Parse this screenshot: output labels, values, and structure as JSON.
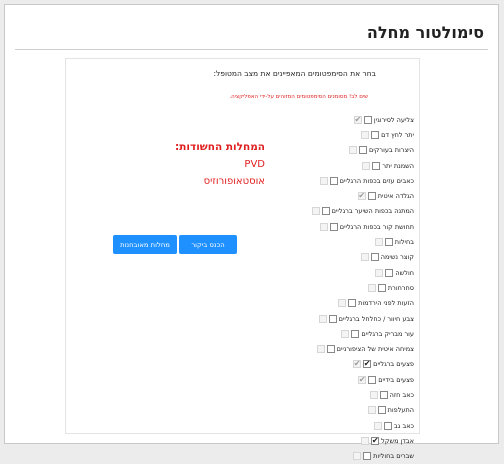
{
  "page": {
    "title": "סימולטור מחלה"
  },
  "form": {
    "instruction": "בחר את הסימפטומים המאפיינים את מצב המטופל:",
    "warning": "שים לב! מסומנים הסימפטומים המזוהים על-ידי האפליקציה."
  },
  "symptoms": [
    {
      "label": "צליעה לסירוגין",
      "user_checked": false,
      "app_checked": true
    },
    {
      "label": "יתר לחץ דם",
      "user_checked": false,
      "app_checked": false
    },
    {
      "label": "היצרות בעורקים",
      "user_checked": false,
      "app_checked": false
    },
    {
      "label": "השמנת יתר",
      "user_checked": false,
      "app_checked": false
    },
    {
      "label": "כאבים עזים בכפות הרגליים",
      "user_checked": false,
      "app_checked": false
    },
    {
      "label": "הגלדה איטית",
      "user_checked": false,
      "app_checked": true
    },
    {
      "label": "המתנה בכפות השיער ברגליים",
      "user_checked": false,
      "app_checked": false
    },
    {
      "label": "תחושת קור בכפות הרגליים",
      "user_checked": false,
      "app_checked": false
    },
    {
      "label": "בחילות",
      "user_checked": false,
      "app_checked": false
    },
    {
      "label": "קוצר נשימה",
      "user_checked": false,
      "app_checked": false
    },
    {
      "label": "חולשה",
      "user_checked": false,
      "app_checked": false
    },
    {
      "label": "סחרחורת",
      "user_checked": false,
      "app_checked": false
    },
    {
      "label": "הזעות לפני הירדמות",
      "user_checked": false,
      "app_checked": false
    },
    {
      "label": "צבע חיוור / כחלחל ברגליים",
      "user_checked": false,
      "app_checked": false
    },
    {
      "label": "עור מבריק ברגליים",
      "user_checked": false,
      "app_checked": false
    },
    {
      "label": "צמיחה איטית של הציפורניים",
      "user_checked": false,
      "app_checked": false
    },
    {
      "label": "פצעים ברגליים",
      "user_checked": true,
      "app_checked": true
    },
    {
      "label": "פצעים בידיים",
      "user_checked": false,
      "app_checked": true
    },
    {
      "label": "כאב חזה",
      "user_checked": false,
      "app_checked": false
    },
    {
      "label": "התעלפות",
      "user_checked": false,
      "app_checked": false
    },
    {
      "label": "כאב גב",
      "user_checked": false,
      "app_checked": false
    },
    {
      "label": "אבדן משקל",
      "user_checked": true,
      "app_checked": false
    },
    {
      "label": "שברים בחוליות",
      "user_checked": false,
      "app_checked": false
    }
  ],
  "diagnosis": {
    "heading": "המחלות החשודות:",
    "items": [
      "PVD",
      "אוסטאופורוזיס"
    ]
  },
  "buttons": {
    "visit": "הכנס ביקור",
    "diagnosed": "מחלות מאובחנות"
  },
  "colors": {
    "accent": "#1e90ff",
    "alert": "#e02020"
  },
  "icons": {
    "checkmark": "check-icon"
  }
}
